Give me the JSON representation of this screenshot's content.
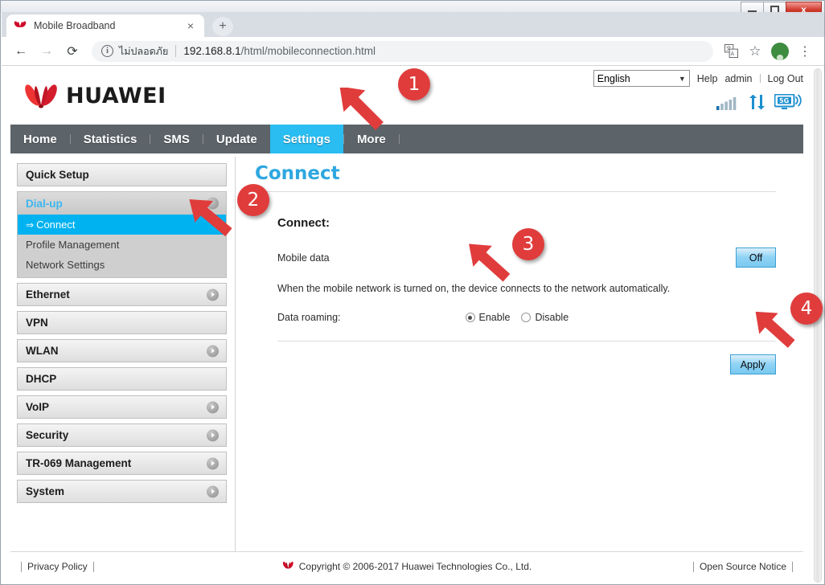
{
  "window": {
    "controls": {
      "minimize": "minimize",
      "restore": "restore",
      "close": "x"
    }
  },
  "browser": {
    "tab": {
      "title": "Mobile Broadband",
      "favicon": "huawei-icon",
      "close": "×"
    },
    "newtab_label": "+",
    "back_icon": "←",
    "forward_icon": "→",
    "reload_icon": "⟳",
    "security": {
      "icon": "info-icon",
      "label": "ไม่ปลอดภัย"
    },
    "url_host": "192.168.8.1",
    "url_path": "/html/mobileconnection.html",
    "translate_icon": "translate-icon",
    "bookmark_icon": "☆",
    "avatar_icon": "profile-avatar",
    "menu_icon": "⋮"
  },
  "header": {
    "brand": "HUAWEI",
    "language": "English",
    "language_options": [
      "English"
    ],
    "links": [
      "Help",
      "admin",
      "Log Out"
    ],
    "status_icons": [
      "signal-bars-icon",
      "data-transfer-icon",
      "5g-network-icon"
    ]
  },
  "nav": {
    "items": [
      {
        "label": "Home",
        "active": false
      },
      {
        "label": "Statistics",
        "active": false
      },
      {
        "label": "SMS",
        "active": false
      },
      {
        "label": "Update",
        "active": false
      },
      {
        "label": "Settings",
        "active": true
      },
      {
        "label": "More",
        "active": false
      }
    ]
  },
  "sidebar": {
    "items": [
      {
        "label": "Quick Setup",
        "type": "box",
        "expandable": false
      },
      {
        "label": "Dial-up",
        "type": "group",
        "expandable": true,
        "children": [
          {
            "label": "Connect",
            "active": true
          },
          {
            "label": "Profile Management",
            "active": false
          },
          {
            "label": "Network Settings",
            "active": false
          }
        ]
      },
      {
        "label": "Ethernet",
        "type": "box",
        "expandable": true
      },
      {
        "label": "VPN",
        "type": "box",
        "expandable": false
      },
      {
        "label": "WLAN",
        "type": "box",
        "expandable": true
      },
      {
        "label": "DHCP",
        "type": "box",
        "expandable": false
      },
      {
        "label": "VoIP",
        "type": "box",
        "expandable": true
      },
      {
        "label": "Security",
        "type": "box",
        "expandable": true
      },
      {
        "label": "TR-069 Management",
        "type": "box",
        "expandable": true
      },
      {
        "label": "System",
        "type": "box",
        "expandable": true
      }
    ]
  },
  "main": {
    "title": "Connect",
    "section_title": "Connect:",
    "mobile_data_label": "Mobile data",
    "mobile_data_state": "Off",
    "description": "When the mobile network is turned on, the device connects to the network automatically.",
    "data_roaming_label": "Data roaming:",
    "radios": [
      {
        "label": "Enable",
        "selected": true
      },
      {
        "label": "Disable",
        "selected": false
      }
    ],
    "apply_label": "Apply"
  },
  "footer": {
    "privacy": "Privacy Policy",
    "copyright": "Copyright © 2006-2017 Huawei Technologies Co., Ltd.",
    "open_source": "Open Source Notice"
  },
  "annotations": [
    {
      "number": "1",
      "target": "settings-tab"
    },
    {
      "number": "2",
      "target": "connect-sidebar-item"
    },
    {
      "number": "3",
      "target": "enable-radio"
    },
    {
      "number": "4",
      "target": "apply-button"
    }
  ],
  "colors": {
    "accent_cyan": "#00b2f0",
    "nav_bg": "#5c6369",
    "title_blue": "#2ea7e0",
    "marker_red": "#e03c3c",
    "huawei_red": "#cf0a2c"
  }
}
